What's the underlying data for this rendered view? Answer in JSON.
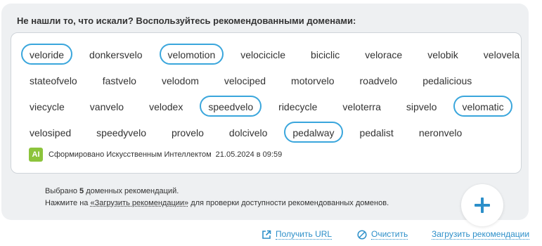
{
  "heading": "Не нашли то, что искали? Воспользуйтесь рекомендованными доменами:",
  "rows": [
    [
      {
        "label": "veloride",
        "selected": true
      },
      {
        "label": "donkersvelo",
        "selected": false
      },
      {
        "label": "velomotion",
        "selected": true
      },
      {
        "label": "velocicicle",
        "selected": false
      },
      {
        "label": "biciclic",
        "selected": false
      },
      {
        "label": "velorace",
        "selected": false
      },
      {
        "label": "velobik",
        "selected": false
      },
      {
        "label": "velovela",
        "selected": false
      }
    ],
    [
      {
        "label": "stateofvelo",
        "selected": false
      },
      {
        "label": "fastvelo",
        "selected": false
      },
      {
        "label": "velodom",
        "selected": false
      },
      {
        "label": "velociped",
        "selected": false
      },
      {
        "label": "motorvelo",
        "selected": false
      },
      {
        "label": "roadvelo",
        "selected": false
      },
      {
        "label": "pedalicious",
        "selected": false
      }
    ],
    [
      {
        "label": "viecycle",
        "selected": false
      },
      {
        "label": "vanvelo",
        "selected": false
      },
      {
        "label": "velodex",
        "selected": false
      },
      {
        "label": "speedvelo",
        "selected": true
      },
      {
        "label": "ridecycle",
        "selected": false
      },
      {
        "label": "veloterra",
        "selected": false
      },
      {
        "label": "sipvelo",
        "selected": false
      },
      {
        "label": "velomatic",
        "selected": true
      }
    ],
    [
      {
        "label": "velosiped",
        "selected": false
      },
      {
        "label": "speedyvelo",
        "selected": false
      },
      {
        "label": "provelo",
        "selected": false
      },
      {
        "label": "dolcivelo",
        "selected": false
      },
      {
        "label": "pedalway",
        "selected": true
      },
      {
        "label": "pedalist",
        "selected": false
      },
      {
        "label": "neronvelo",
        "selected": false
      }
    ]
  ],
  "ai": {
    "badge": "AI",
    "text": "Сформировано Искусственным Интеллектом",
    "date": "21.05.2024 в 09:59"
  },
  "info": {
    "line1_prefix": "Выбрано ",
    "count": "5",
    "line1_suffix": " доменных рекомендаций.",
    "line2_prefix": "Нажмите на ",
    "line2_link": "«Загрузить рекомендации»",
    "line2_suffix": " для проверки доступности рекомендованных доменов."
  },
  "actions": {
    "get_url": "Получить URL",
    "clear": "Очистить",
    "load": "Загрузить рекомендации"
  },
  "colors": {
    "accent": "#2c8fc9",
    "chip_selected_border": "#3aa6dc",
    "ai_badge": "#8cc43c",
    "panel_bg": "#eef0f2"
  },
  "icons": {
    "fab": "plus-icon",
    "get_url": "external-link-icon",
    "clear": "clear-icon"
  }
}
